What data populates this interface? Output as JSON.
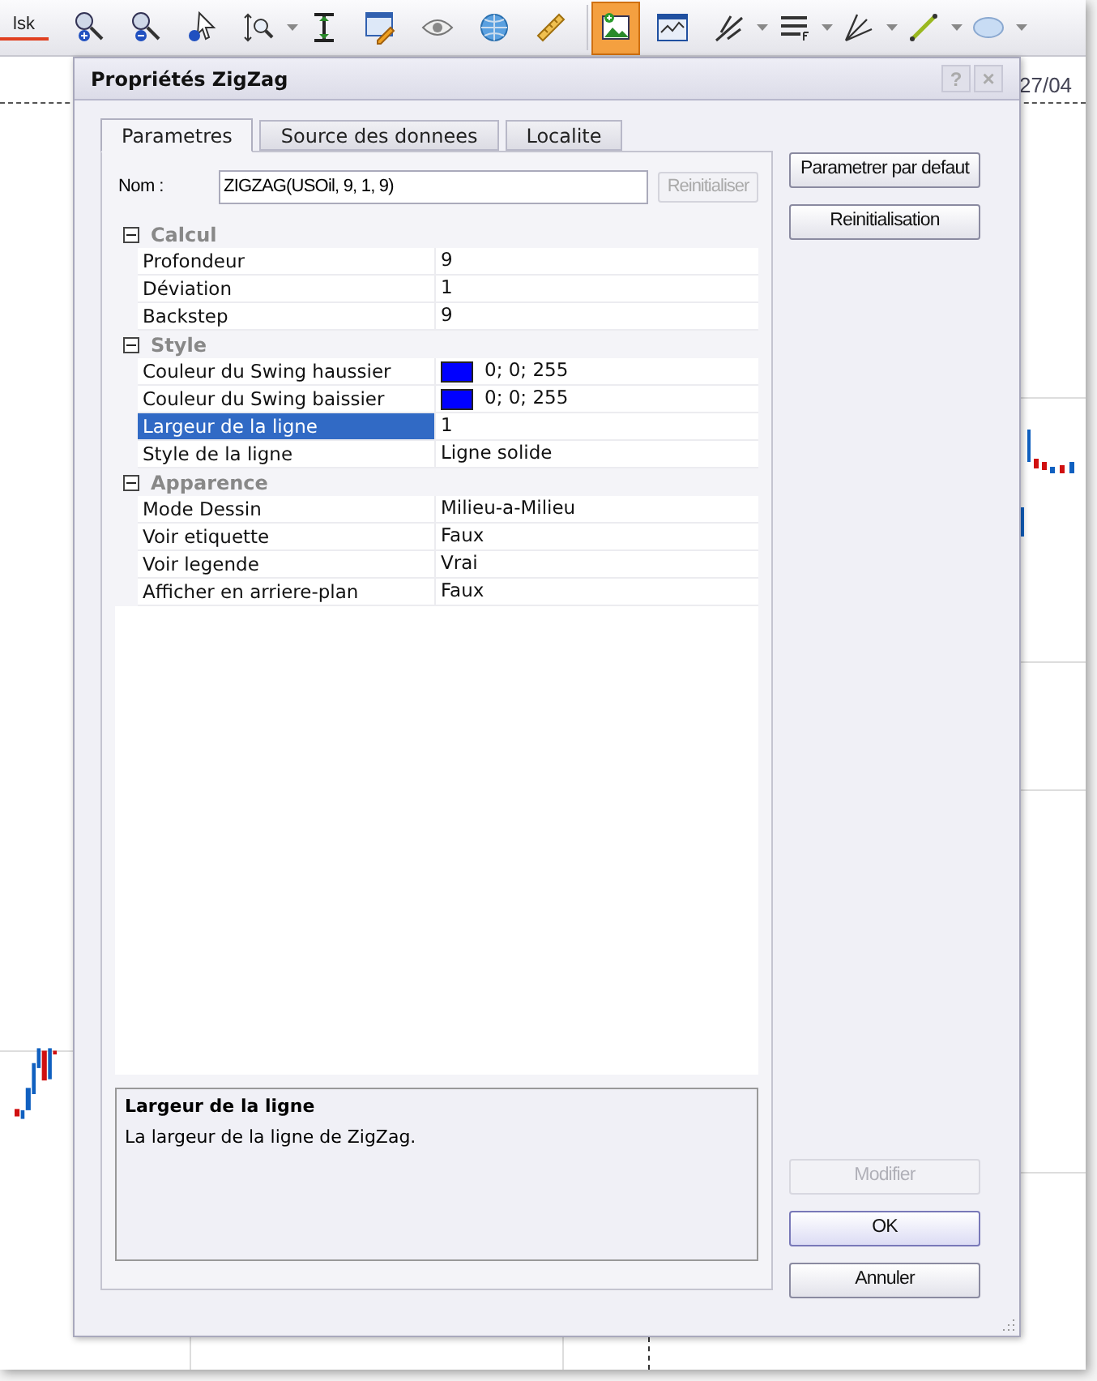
{
  "toolbar": {
    "cut_label": "lsk",
    "tools": [
      {
        "selected": false
      },
      {
        "selected": false
      },
      {
        "selected": false
      },
      {
        "selected": false,
        "has_menu": true
      },
      {
        "selected": false
      },
      {
        "selected": false
      },
      {
        "selected": false
      },
      {
        "selected": false
      },
      {
        "selected": false
      },
      {
        "selected": true
      },
      {
        "selected": false
      },
      {
        "selected": false,
        "has_menu": true
      },
      {
        "selected": false,
        "has_menu": true
      },
      {
        "selected": false,
        "has_menu": true
      },
      {
        "selected": false,
        "has_menu": true
      },
      {
        "selected": false,
        "has_menu": true
      }
    ]
  },
  "chart": {
    "date_label": "27/04"
  },
  "dialog": {
    "title": "Propriétés ZigZag",
    "help_button": "?",
    "close_button": "×",
    "tabs": [
      {
        "label": "Parametres",
        "selected": true
      },
      {
        "label": "Source des donnees",
        "selected": false
      },
      {
        "label": "Localite",
        "selected": false
      }
    ],
    "name_field": {
      "label": "Nom :",
      "value": "ZIGZAG(USOil, 9, 1, 9)",
      "reset_button": {
        "label": "Reinitialiser",
        "disabled": true
      }
    },
    "categories": [
      {
        "name": "Calcul",
        "expanded": true,
        "rows": [
          {
            "name": "Profondeur",
            "value": "9",
            "selected": false
          },
          {
            "name": "Déviation",
            "value": "1",
            "selected": false
          },
          {
            "name": "Backstep",
            "value": "9",
            "selected": false
          }
        ]
      },
      {
        "name": "Style",
        "expanded": true,
        "rows": [
          {
            "name": "Couleur du Swing haussier",
            "value": "0; 0; 255",
            "color": "#0000ff",
            "selected": false
          },
          {
            "name": "Couleur du Swing baissier",
            "value": "0; 0; 255",
            "color": "#0000ff",
            "selected": false
          },
          {
            "name": "Largeur de la ligne",
            "value": "1",
            "selected": true
          },
          {
            "name": "Style de la ligne",
            "value": "Ligne solide",
            "selected": false
          }
        ]
      },
      {
        "name": "Apparence",
        "expanded": true,
        "rows": [
          {
            "name": "Mode Dessin",
            "value": "Milieu-a-Milieu",
            "selected": false
          },
          {
            "name": "Voir etiquette",
            "value": "Faux",
            "selected": false
          },
          {
            "name": "Voir legende",
            "value": "Vrai",
            "selected": false
          },
          {
            "name": "Afficher en arriere-plan",
            "value": "Faux",
            "selected": false
          }
        ]
      }
    ],
    "description": {
      "title": "Largeur de la ligne",
      "text": "La largeur de la ligne de ZigZag."
    },
    "side_buttons": [
      {
        "label": "Parametrer par defaut",
        "disabled": false
      },
      {
        "label": "Reinitialisation",
        "disabled": false
      }
    ],
    "bottom_buttons": [
      {
        "label": "Modifier",
        "disabled": true
      },
      {
        "label": "OK",
        "disabled": false,
        "default": true
      },
      {
        "label": "Annuler",
        "disabled": false,
        "default": false
      }
    ]
  }
}
